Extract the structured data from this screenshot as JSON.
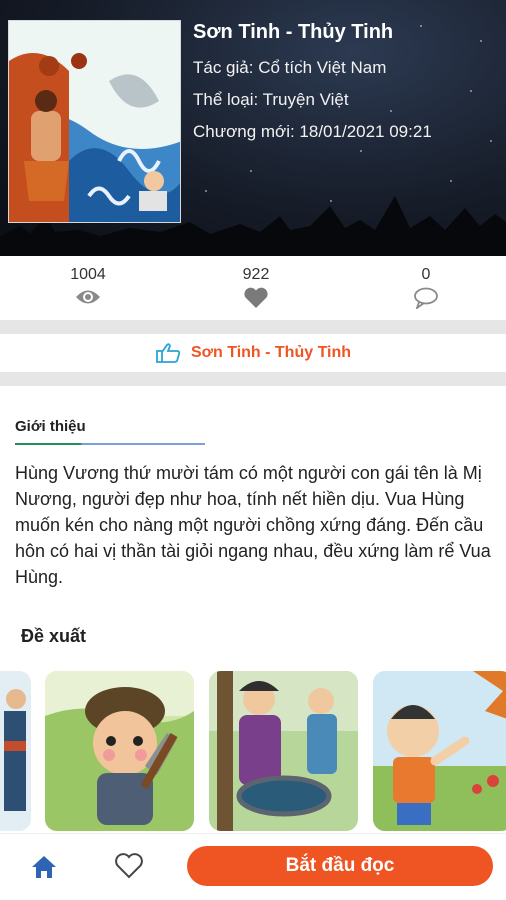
{
  "story": {
    "title": "Sơn Tinh - Thủy Tinh",
    "author": "Tác giả: Cổ tích Việt Nam",
    "genre": "Thể loại: Truyện Việt",
    "latest_chapter": "Chương mới: 18/01/2021 09:21"
  },
  "stats": {
    "views": "1004",
    "likes": "922",
    "comments": "0"
  },
  "chapter_link": {
    "label": "Sơn Tinh - Thủy Tinh"
  },
  "intro": {
    "heading": "Giới thiệu",
    "text": "Hùng Vương thứ mười tám có một người con gái tên là Mị Nương, người đẹp như hoa, tính nết hiền dịu. Vua Hùng muốn kén cho nàng một người chồng xứng đáng. Đến cầu hôn có hai vị thần tài giỏi ngang nhau, đều xứng làm rể Vua Hùng."
  },
  "suggest": {
    "heading": "Đề xuất"
  },
  "bottom_bar": {
    "start_label": "Bắt đầu đọc"
  },
  "colors": {
    "accent": "#ef5423",
    "link_icon": "#29a3d8",
    "home_icon": "#2f64b5"
  }
}
